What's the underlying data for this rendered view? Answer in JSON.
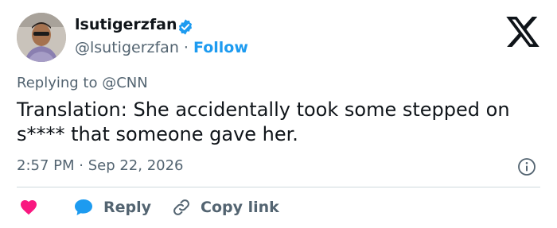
{
  "author": {
    "display_name": "lsutigerzfan",
    "handle_line_handle": "@lsutigerzfan",
    "separator": "·",
    "follow_label": "Follow",
    "verified": true
  },
  "reply_context": "Replying to @CNN",
  "tweet": {
    "text": "Translation: She accidentally took some stepped on s**** that someone gave her."
  },
  "meta": {
    "timestamp": "2:57 PM · Sep 22, 2026"
  },
  "actions": {
    "reply_label": "Reply",
    "copy_link_label": "Copy link"
  },
  "colors": {
    "accent": "#1d9bf0",
    "like": "#f91880",
    "muted": "#536471",
    "text": "#0f1419"
  },
  "icons": [
    "x-logo-icon",
    "verified-badge-icon",
    "heart-icon",
    "reply-bubble-icon",
    "link-icon",
    "info-icon"
  ]
}
